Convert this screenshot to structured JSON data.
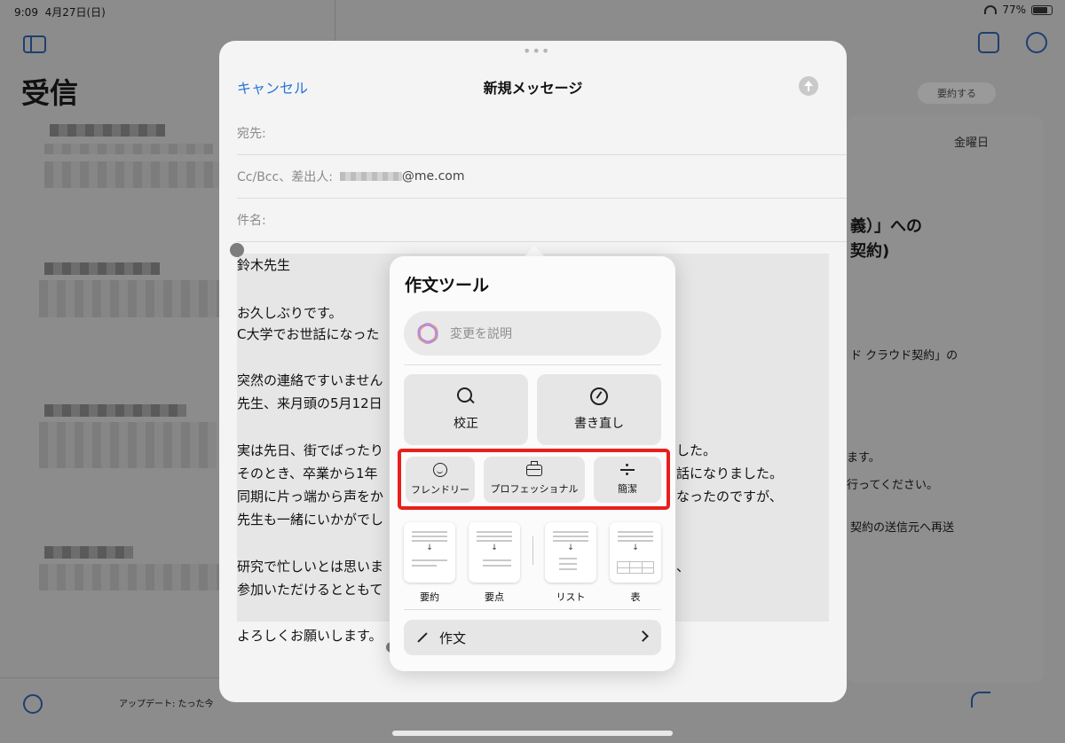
{
  "status_bar": {
    "time": "9:09",
    "date": "4月27日(日)",
    "battery": "77%"
  },
  "mailbox": {
    "title": "受信",
    "update_status": "アップデート: たった今"
  },
  "message_view": {
    "summarize_label": "要約する",
    "date": "金曜日",
    "heading_line1": "義）」への",
    "heading_line2": "契約)",
    "line1": "ド クラウド契約」の",
    "line2": "ます。",
    "line3": "行ってください。",
    "line4": "契約の送信元へ再送"
  },
  "compose": {
    "cancel_label": "キャンセル",
    "title": "新規メッセージ",
    "to_label": "宛先:",
    "cc_label": "Cc/Bcc、差出人:",
    "from_domain": "@me.com",
    "subject_label": "件名:",
    "body": {
      "line1": "鈴木先生",
      "line2": "お久しぶりです。",
      "line3": "C大学でお世話になった",
      "line4": "突然の連絡ですいません",
      "line5": "先生、来月頭の5月12日",
      "line6a": "実は先日、街でばったり",
      "line6b": "した。",
      "line7a": "そのとき、卒業から1年",
      "line7b": "話になりました。",
      "line8a": "同期に片っ端から声をか",
      "line8b": "なったのですが、",
      "line9": "先生も一緒にいかがでし",
      "line10a": "研究で忙しいとは思いま",
      "line10b": "、",
      "line11": "参加いただけるとともて",
      "line12": "よろしくお願いします。"
    }
  },
  "writing_tools": {
    "title": "作文ツール",
    "describe_placeholder": "変更を説明",
    "proofread_label": "校正",
    "rewrite_label": "書き直し",
    "friendly_label": "フレンドリー",
    "professional_label": "プロフェッショナル",
    "concise_label": "簡潔",
    "summary_label": "要約",
    "key_points_label": "要点",
    "list_label": "リスト",
    "table_label": "表",
    "compose_label": "作文",
    "highlight_color": "#e8201c"
  }
}
